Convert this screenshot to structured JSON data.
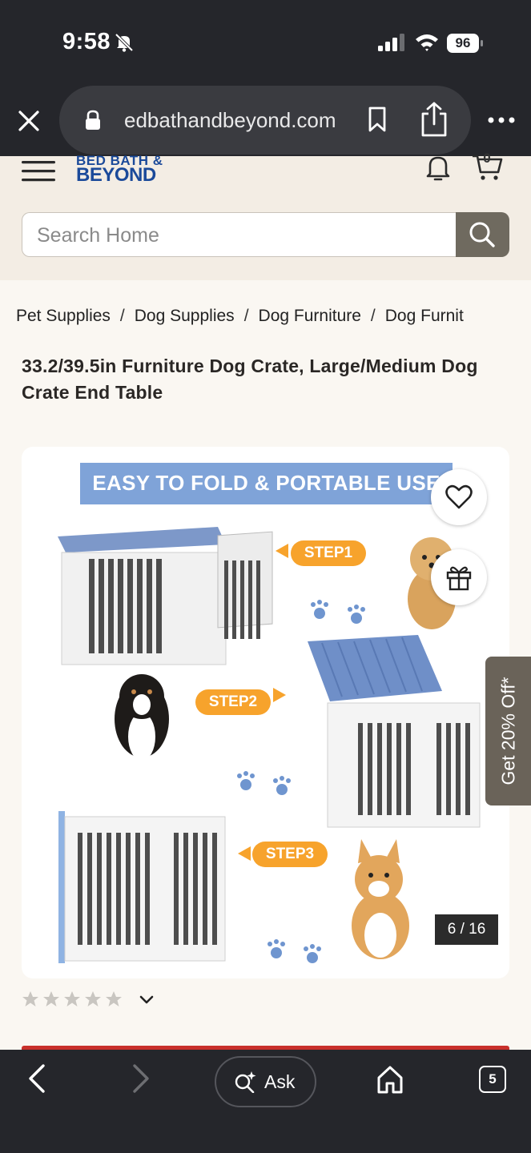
{
  "status_bar": {
    "time": "9:58",
    "battery_level": "96",
    "icons": [
      "bell-slash-icon",
      "cellular-signal-icon",
      "wifi-icon",
      "battery-icon"
    ]
  },
  "browser": {
    "url": "edbathandbeyond.com",
    "icons": [
      "close-icon",
      "lock-icon",
      "bookmark-icon",
      "share-icon",
      "more-icon"
    ]
  },
  "header": {
    "logo_line1": "BED BATH &",
    "logo_line2": "BEYOND",
    "cart_count": "0",
    "search_placeholder": "Search Home",
    "icons": [
      "menu-icon",
      "bell-icon",
      "cart-icon",
      "search-icon"
    ]
  },
  "breadcrumb": [
    "Pet Supplies",
    "Dog Supplies",
    "Dog Furniture",
    "Dog Furnit"
  ],
  "product": {
    "title": "33.2/39.5in Furniture Dog Crate, Large/Medium Dog Crate End Table",
    "image_counter": "6 / 16",
    "image_banner": "EASY TO FOLD & PORTABLE USE",
    "steps": [
      "STEP1",
      "STEP2",
      "STEP3"
    ],
    "rating_stars": 0,
    "rating_max": 5
  },
  "promo": {
    "label": "Get 20% Off*"
  },
  "toolbar": {
    "ask_label": "Ask",
    "tab_count": "5",
    "icons": [
      "back-icon",
      "forward-icon",
      "ask-sparkle-icon",
      "home-icon",
      "tabs-icon"
    ]
  },
  "colors": {
    "system_bar": "#25262b",
    "header_bg": "#f3ede4",
    "brand_blue": "#1b4a9a",
    "search_button": "#6f6a5f",
    "promo_tab": "#6a6359",
    "step_orange": "#f7a32c",
    "banner_blue": "#7fa3d8"
  }
}
